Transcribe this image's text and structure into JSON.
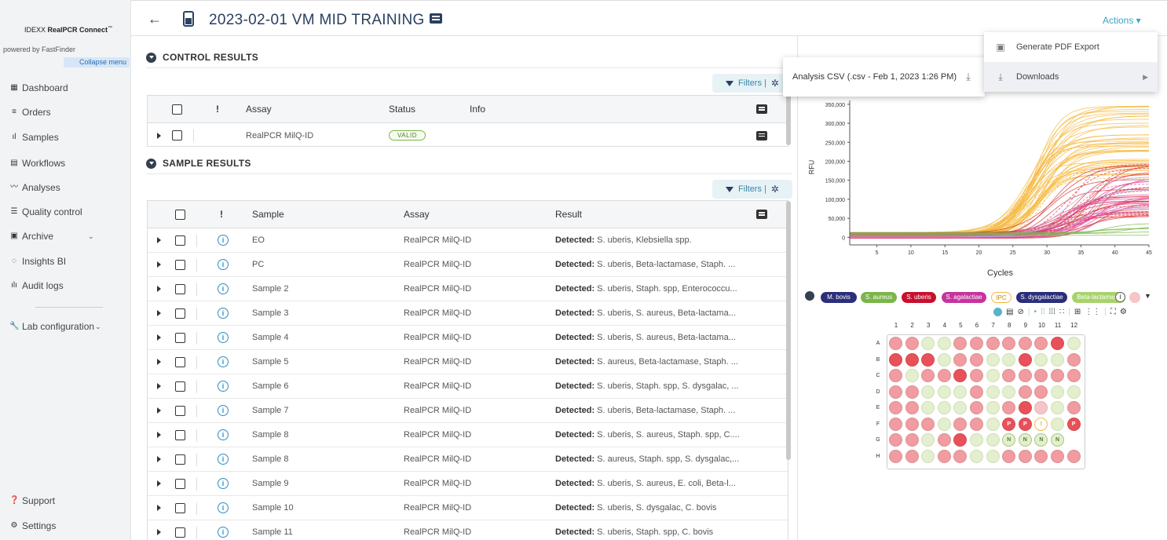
{
  "sidebar": {
    "brand_prefix": "IDEXX ",
    "brand_name": "RealPCR Connect",
    "brand_tm": "™",
    "powered": "powered by FastFinder",
    "collapse": "Collapse menu",
    "items": [
      {
        "label": "Dashboard",
        "icon": "dashboard-icon"
      },
      {
        "label": "Orders",
        "icon": "orders-icon"
      },
      {
        "label": "Samples",
        "icon": "samples-icon"
      },
      {
        "label": "Workflows",
        "icon": "workflows-icon"
      },
      {
        "label": "Analyses",
        "icon": "analyses-icon"
      },
      {
        "label": "Quality control",
        "icon": "quality-control-icon"
      },
      {
        "label": "Archive",
        "icon": "archive-icon"
      },
      {
        "label": "Insights BI",
        "icon": "insights-icon"
      },
      {
        "label": "Audit logs",
        "icon": "audit-logs-icon"
      }
    ],
    "lab_config": "Lab configuration",
    "support": "Support",
    "settings": "Settings"
  },
  "header": {
    "title": "2023-02-01 VM MID TRAINING",
    "actions": "Actions ▾"
  },
  "control": {
    "section_title": "CONTROL RESULTS",
    "filters": "Filters |",
    "columns": {
      "warning": "!",
      "assay": "Assay",
      "status": "Status",
      "info": "Info"
    },
    "rows": [
      {
        "assay": "RealPCR MilQ-ID",
        "status": "VALID"
      }
    ]
  },
  "samples": {
    "section_title": "SAMPLE RESULTS",
    "filters": "Filters |",
    "columns": {
      "warning": "!",
      "sample": "Sample",
      "assay": "Assay",
      "result": "Result"
    },
    "rows": [
      {
        "sample": "EO",
        "assay": "RealPCR MilQ-ID",
        "detected": "Detected:",
        "result": " S. uberis, Klebsiella spp."
      },
      {
        "sample": "PC",
        "assay": "RealPCR MilQ-ID",
        "detected": "Detected:",
        "result": " S. uberis, Beta-lactamase, Staph. ..."
      },
      {
        "sample": "Sample 2",
        "assay": "RealPCR MilQ-ID",
        "detected": "Detected:",
        "result": " S. uberis, Staph. spp, Enterococcu..."
      },
      {
        "sample": "Sample 3",
        "assay": "RealPCR MilQ-ID",
        "detected": "Detected:",
        "result": " S. uberis, S. aureus, Beta-lactama..."
      },
      {
        "sample": "Sample 4",
        "assay": "RealPCR MilQ-ID",
        "detected": "Detected:",
        "result": " S. uberis, S. aureus, Beta-lactama..."
      },
      {
        "sample": "Sample 5",
        "assay": "RealPCR MilQ-ID",
        "detected": "Detected:",
        "result": " S. aureus, Beta-lactamase, Staph. ..."
      },
      {
        "sample": "Sample 6",
        "assay": "RealPCR MilQ-ID",
        "detected": "Detected:",
        "result": " S. uberis, Staph. spp, S. dysgalac, ..."
      },
      {
        "sample": "Sample 7",
        "assay": "RealPCR MilQ-ID",
        "detected": "Detected:",
        "result": " S. uberis, Beta-lactamase, Staph. ..."
      },
      {
        "sample": "Sample 8",
        "assay": "RealPCR MilQ-ID",
        "detected": "Detected:",
        "result": " S. uberis, S. aureus, Staph. spp, C...."
      },
      {
        "sample": "Sample 8",
        "assay": "RealPCR MilQ-ID",
        "detected": "Detected:",
        "result": " S. aureus, Staph. spp, S. dysgalac,..."
      },
      {
        "sample": "Sample 9",
        "assay": "RealPCR MilQ-ID",
        "detected": "Detected:",
        "result": " S. uberis, S. aureus, E. coli, Beta-l..."
      },
      {
        "sample": "Sample 10",
        "assay": "RealPCR MilQ-ID",
        "detected": "Detected:",
        "result": " S. uberis, S. dysgalac, C. bovis"
      },
      {
        "sample": "Sample 11",
        "assay": "RealPCR MilQ-ID",
        "detected": "Detected:",
        "result": " S. uberis, Staph. spp, C. bovis"
      }
    ]
  },
  "popup": {
    "csv": "Analysis CSV  (.csv - Feb 1, 2023 1:26 PM)"
  },
  "menu": {
    "pdf": "Generate PDF Export",
    "downloads": "Downloads"
  },
  "chart_data": {
    "type": "line",
    "xlabel": "Cycles",
    "ylabel": "RFU",
    "xticks": [
      5,
      10,
      15,
      20,
      25,
      30,
      35,
      40,
      45
    ],
    "yticks": [
      "0",
      "50,000",
      "100,000",
      "150,000",
      "200,000",
      "250,000",
      "300,000",
      "350,000"
    ],
    "xlim": [
      1,
      45
    ],
    "ylim": [
      -20000,
      360000
    ],
    "curve_families": [
      {
        "color": "#f5b942",
        "count": 45,
        "plateau_range": [
          150000,
          340000
        ],
        "midpoint_range": [
          27,
          30
        ]
      },
      {
        "color": "#d8343a",
        "count": 30,
        "plateau_range": [
          40000,
          200000
        ],
        "midpoint_range": [
          30,
          38
        ]
      },
      {
        "color": "#e0489e",
        "count": 14,
        "plateau_range": [
          60000,
          150000
        ],
        "midpoint_range": [
          31,
          38
        ]
      },
      {
        "color": "#c69adb",
        "count": 6,
        "plateau_range": [
          60000,
          160000
        ],
        "midpoint_range": [
          33,
          40
        ]
      },
      {
        "color": "#7ab648",
        "count": 6,
        "plateau_range": [
          0,
          30000
        ],
        "midpoint_range": [
          36,
          44
        ]
      }
    ]
  },
  "legend": {
    "chips": [
      {
        "label": "M. bovis",
        "color": "#2b2f7a"
      },
      {
        "label": "S. aureus",
        "color": "#7ab648"
      },
      {
        "label": "S. uberis",
        "color": "#c8102e"
      },
      {
        "label": "S. agalactiae",
        "color": "#c6349e"
      },
      {
        "label": "IPC",
        "color": "#f5b942"
      },
      {
        "label": "S. dysgalactiae",
        "color": "#2b2f7a"
      },
      {
        "label": "Beta-lactamase",
        "color": "#a8d36b"
      }
    ]
  },
  "plate": {
    "rows": [
      "A",
      "B",
      "C",
      "D",
      "E",
      "F",
      "G",
      "H"
    ],
    "cols": [
      "1",
      "2",
      "3",
      "4",
      "5",
      "6",
      "7",
      "8",
      "9",
      "10",
      "11",
      "12"
    ],
    "wells": [
      [
        "r",
        "r",
        "g",
        "g",
        "r",
        "r",
        "r",
        "r",
        "r",
        "r",
        "R",
        "g"
      ],
      [
        "R",
        "R",
        "R",
        "g",
        "r",
        "r",
        "g",
        "g",
        "R",
        "g",
        "g",
        "r"
      ],
      [
        "r",
        "g",
        "r",
        "r",
        "R",
        "r",
        "g",
        "r",
        "r",
        "r",
        "r",
        "r"
      ],
      [
        "r",
        "r",
        "g",
        "g",
        "g",
        "r",
        "g",
        "g",
        "r",
        "r",
        "g",
        "g"
      ],
      [
        "r",
        "r",
        "g",
        "g",
        "g",
        "r",
        "g",
        "r",
        "R",
        "p",
        "g",
        "r"
      ],
      [
        "r",
        "r",
        "r",
        "g",
        "r",
        "r",
        "g",
        "P",
        "P",
        "!",
        "g",
        "P"
      ],
      [
        "r",
        "r",
        "g",
        "r",
        "R",
        "g",
        "g",
        "N",
        "N",
        "N",
        "N",
        ""
      ],
      [
        "r",
        "r",
        "g",
        "r",
        "r",
        "g",
        "g",
        "r",
        "r",
        "r",
        "r",
        "r"
      ]
    ],
    "well_colors": {
      "r": "#f09ca0",
      "R": "#e8505a",
      "g": "#e3efcd",
      "p": "#f6c5c8"
    }
  }
}
